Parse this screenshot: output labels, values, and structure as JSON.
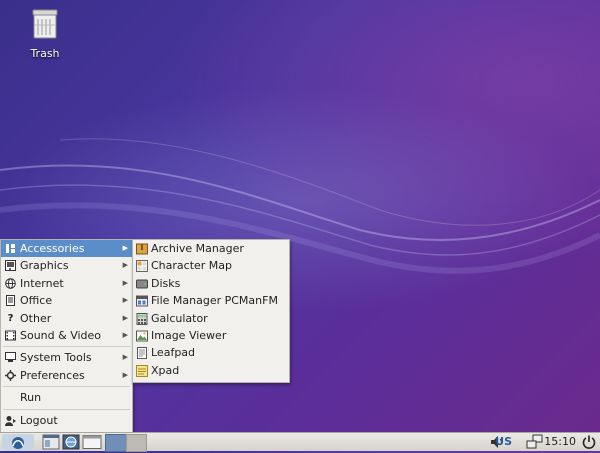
{
  "desktop": {
    "icons": [
      {
        "label": "Trash",
        "icon": "trash-icon"
      }
    ]
  },
  "main_menu": {
    "items": [
      {
        "label": "Accessories",
        "icon": "accessories-icon",
        "submenu": true,
        "highlighted": true
      },
      {
        "label": "Graphics",
        "icon": "graphics-icon",
        "submenu": true
      },
      {
        "label": "Internet",
        "icon": "internet-icon",
        "submenu": true
      },
      {
        "label": "Office",
        "icon": "office-icon",
        "submenu": true
      },
      {
        "label": "Other",
        "icon": "other-icon",
        "submenu": true
      },
      {
        "label": "Sound & Video",
        "icon": "sound-video-icon",
        "submenu": true
      },
      {
        "label": "System Tools",
        "icon": "system-tools-icon",
        "submenu": true
      },
      {
        "label": "Preferences",
        "icon": "preferences-icon",
        "submenu": true
      },
      {
        "label": "Run",
        "icon": ""
      },
      {
        "label": "Logout",
        "icon": "logout-icon"
      }
    ]
  },
  "accessories_menu": {
    "items": [
      {
        "label": "Archive Manager",
        "icon": "archive-manager-icon"
      },
      {
        "label": "Character Map",
        "icon": "character-map-icon"
      },
      {
        "label": "Disks",
        "icon": "disks-icon"
      },
      {
        "label": "File Manager PCManFM",
        "icon": "file-manager-icon"
      },
      {
        "label": "Galculator",
        "icon": "calculator-icon"
      },
      {
        "label": "Image Viewer",
        "icon": "image-viewer-icon"
      },
      {
        "label": "Leafpad",
        "icon": "leafpad-icon"
      },
      {
        "label": "Xpad",
        "icon": "xpad-icon"
      }
    ]
  },
  "taskbar": {
    "keyboard_layout": "US",
    "clock": "15:10"
  },
  "colors": {
    "menu_highlight": "#5b8ec9",
    "menu_background": "#f1f0ed",
    "desktop_purple": "#4a36a0"
  }
}
